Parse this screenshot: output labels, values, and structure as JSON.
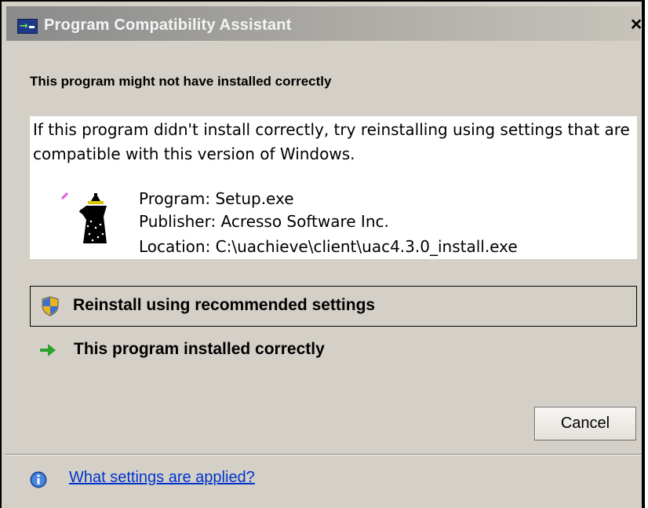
{
  "window": {
    "title": "Program Compatibility Assistant",
    "close_glyph": "×"
  },
  "main": {
    "heading": "This program might not have installed correctly",
    "message": "If this program didn't install correctly, try reinstalling using settings that are compatible with this version of Windows.",
    "program_icon": "setup-wizard-icon",
    "details": {
      "program": "Program: Setup.exe",
      "publisher": "Publisher: Acresso Software Inc.",
      "location": "Location: C:\\uachieve\\client\\uac4.3.0_install.exe"
    }
  },
  "options": {
    "reinstall": {
      "label": "Reinstall using recommended settings",
      "icon": "uac-shield-icon"
    },
    "installed_correctly": {
      "label": "This program installed correctly",
      "icon": "green-arrow-icon"
    }
  },
  "buttons": {
    "cancel": "Cancel"
  },
  "footer": {
    "link": "What settings are applied?",
    "icon": "info-icon"
  },
  "colors": {
    "link": "#0033cc",
    "arrow": "#2aa32a",
    "dialog_bg": "#d4d0c8"
  }
}
